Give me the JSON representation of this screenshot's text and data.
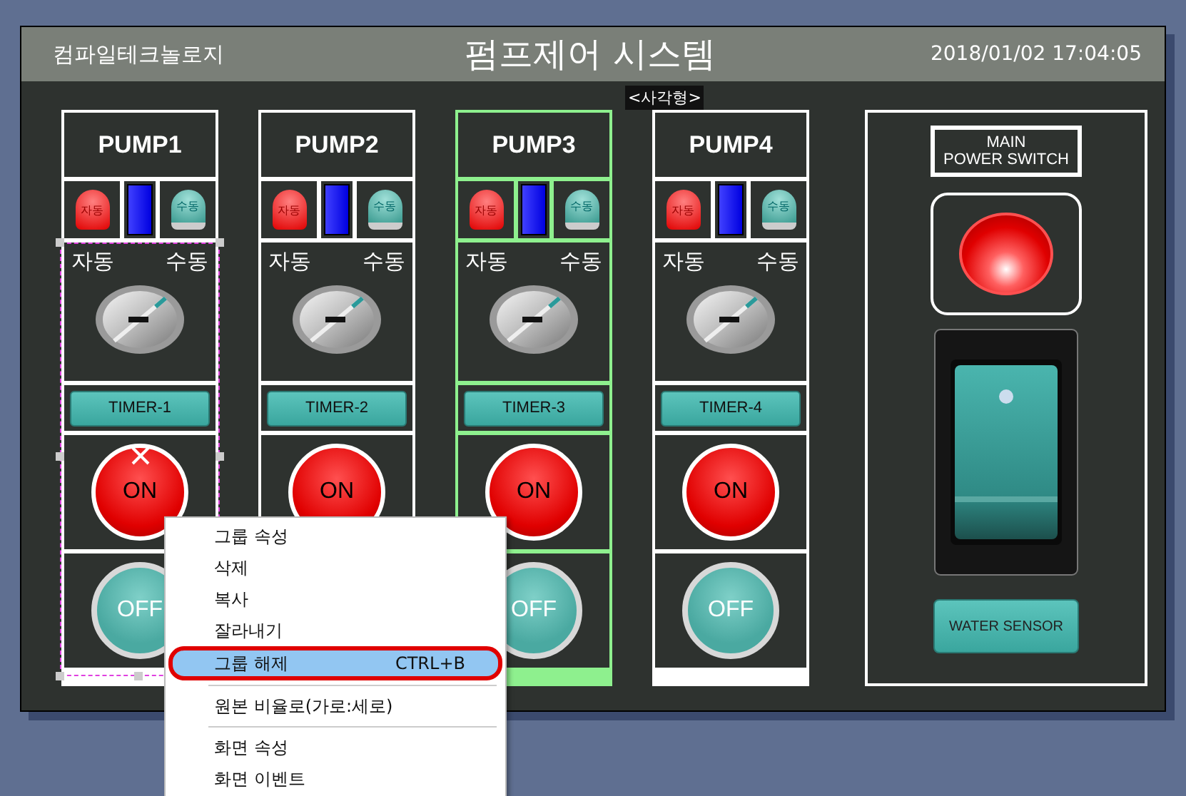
{
  "header": {
    "company": "컴파일테크놀로지",
    "title": "펌프제어 시스템",
    "datetime": "2018/01/02 17:04:05"
  },
  "pumps": [
    {
      "name": "PUMP1",
      "red_lamp": "자동",
      "green_lamp": "수동",
      "auto_label": "자동",
      "manual_label": "수동",
      "timer": "TIMER-1",
      "on_label": "ON",
      "off_label": "OFF",
      "selected": true,
      "highlighted": false
    },
    {
      "name": "PUMP2",
      "red_lamp": "자동",
      "green_lamp": "수동",
      "auto_label": "자동",
      "manual_label": "수동",
      "timer": "TIMER-2",
      "on_label": "ON",
      "selected": false,
      "highlighted": false
    },
    {
      "name": "PUMP3",
      "red_lamp": "자동",
      "green_lamp": "수동",
      "auto_label": "자동",
      "manual_label": "수동",
      "timer": "TIMER-3",
      "on_label": "ON",
      "off_label": "OFF",
      "selected": false,
      "highlighted": true
    },
    {
      "name": "PUMP4",
      "red_lamp": "자동",
      "green_lamp": "수동",
      "auto_label": "자동",
      "manual_label": "수동",
      "timer": "TIMER-4",
      "on_label": "ON",
      "off_label": "OFF",
      "selected": false,
      "highlighted": false
    }
  ],
  "tooltip": "<사각형>",
  "main_panel": {
    "title_lines": [
      "MAIN",
      "POWER SWITCH"
    ],
    "sensor_button": "WATER SENSOR"
  },
  "context_menu": [
    {
      "label": "그룹 속성",
      "selected": false
    },
    {
      "label": "삭제",
      "selected": false
    },
    {
      "label": "복사",
      "selected": false
    },
    {
      "label": "잘라내기",
      "selected": false
    },
    {
      "label": "그룹 해제",
      "shortcut": "CTRL+B",
      "selected": true
    },
    {
      "kind": "separator"
    },
    {
      "label": "원본 비율로(가로:세로)",
      "selected": false
    },
    {
      "kind": "separator"
    },
    {
      "label": "화면 속성",
      "selected": false
    },
    {
      "label": "화면 이벤트",
      "selected": false
    }
  ]
}
